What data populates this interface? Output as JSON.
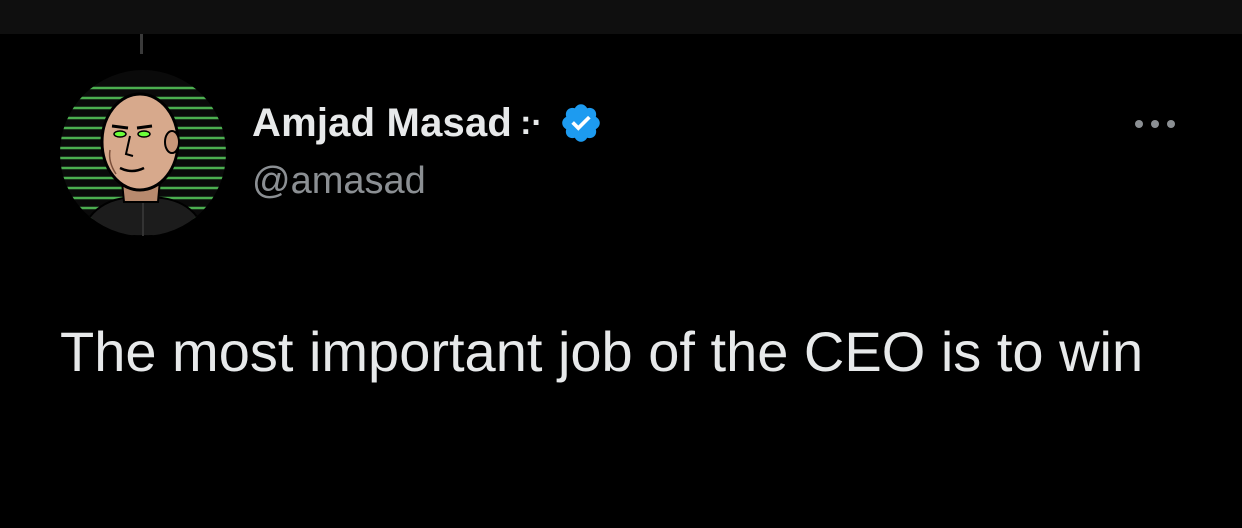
{
  "tweet": {
    "author": {
      "display_name": "Amjad Masad",
      "name_suffix": ":·",
      "handle": "@amasad",
      "verified": true,
      "avatar": "avatar-illustration"
    },
    "text": "The most important job of the CEO is to win",
    "menu_icon": "more-dots-icon"
  },
  "colors": {
    "background": "#000000",
    "text_primary": "#e7e9ea",
    "text_secondary": "#8b8f93",
    "verified_blue": "#1d9bf0",
    "avatar_stripes": "#4caf50"
  }
}
